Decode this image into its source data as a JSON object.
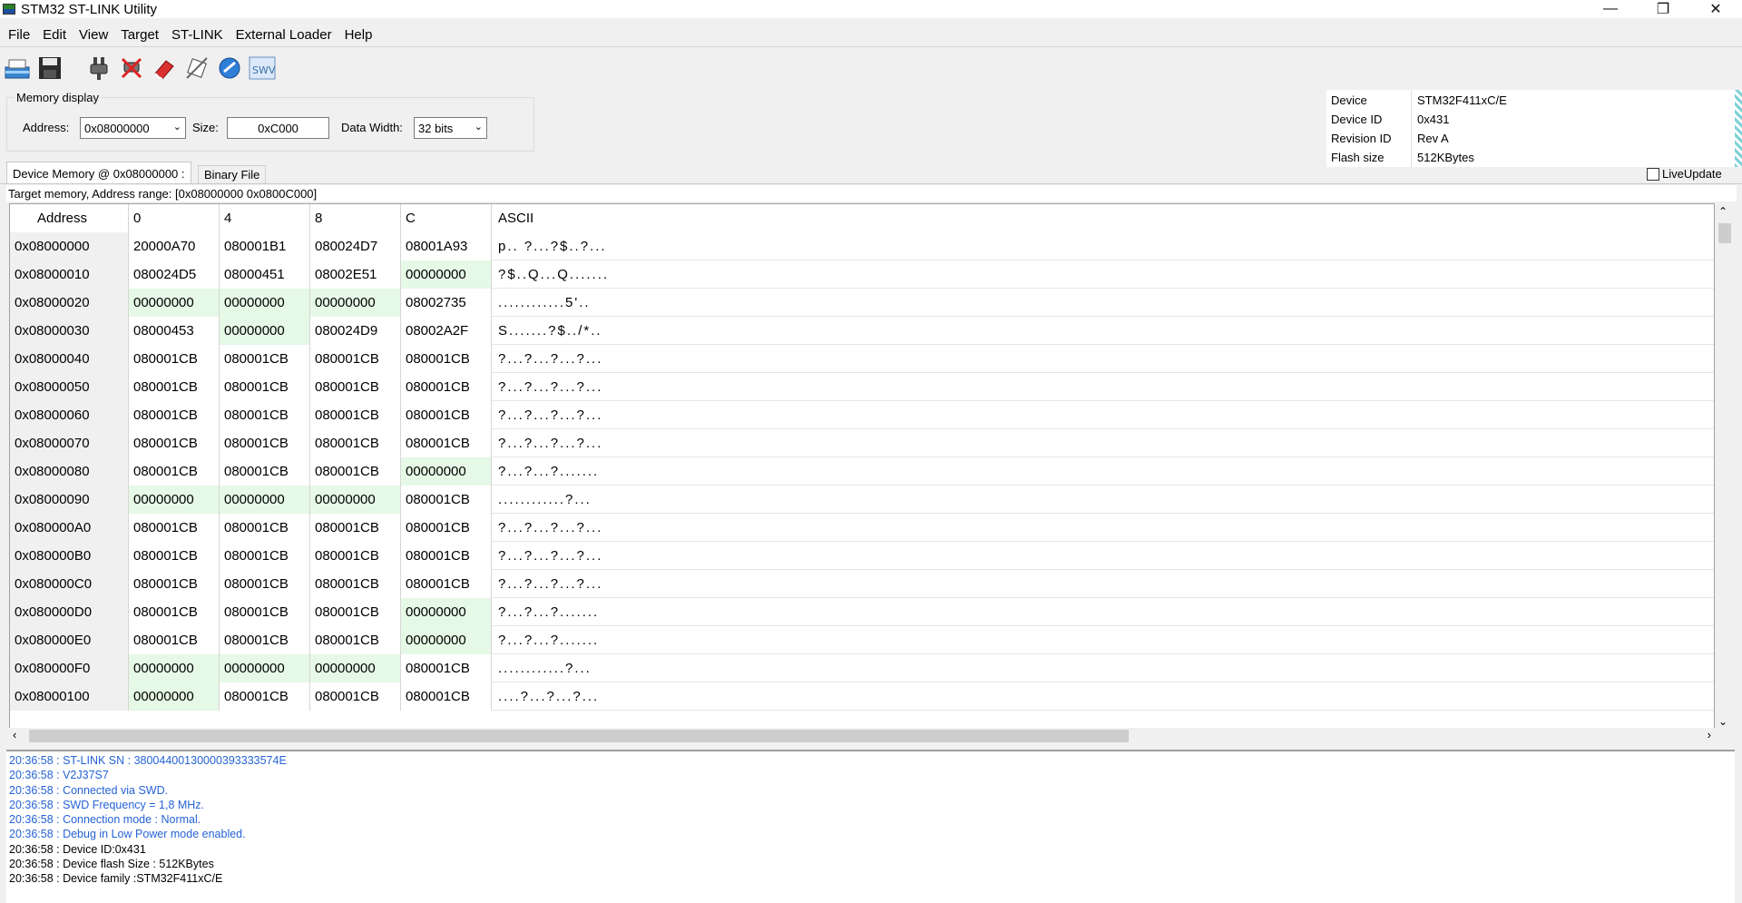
{
  "window": {
    "title": "STM32 ST-LINK Utility",
    "controls": {
      "minimize": "—",
      "restore": "❐",
      "close": "✕"
    }
  },
  "menu": [
    "File",
    "Edit",
    "View",
    "Target",
    "ST-LINK",
    "External Loader",
    "Help"
  ],
  "toolbar": {
    "icons": [
      "open-file-icon",
      "save-icon",
      "connect-icon",
      "disconnect-icon",
      "erase-icon",
      "program-icon",
      "external-loader-icon",
      "swv-icon"
    ],
    "swv_label": "SWV"
  },
  "memory_display": {
    "group_title": "Memory display",
    "address_label": "Address:",
    "address_value": "0x08000000",
    "size_label": "Size:",
    "size_value": "0xC000",
    "width_label": "Data Width:",
    "width_value": "32 bits"
  },
  "device_info": [
    {
      "key": "Device",
      "value": "STM32F411xC/E"
    },
    {
      "key": "Device ID",
      "value": "0x431"
    },
    {
      "key": "Revision ID",
      "value": "Rev A"
    },
    {
      "key": "Flash size",
      "value": "512KBytes"
    }
  ],
  "live_update_label": "LiveUpdate",
  "tabs": {
    "device_memory": "Device Memory @ 0x08000000 :",
    "binary_file": "Binary File"
  },
  "range_text": "Target memory, Address range: [0x08000000 0x0800C000]",
  "table": {
    "headers": [
      "Address",
      "0",
      "4",
      "8",
      "C",
      "ASCII"
    ],
    "rows": [
      {
        "addr": "0x08000000",
        "w": [
          "20000A70",
          "080001B1",
          "080024D7",
          "08001A93"
        ],
        "ascii": "p.. ?...?$..?..."
      },
      {
        "addr": "0x08000010",
        "w": [
          "080024D5",
          "08000451",
          "08002E51",
          "00000000"
        ],
        "ascii": "?$..Q...Q......."
      },
      {
        "addr": "0x08000020",
        "w": [
          "00000000",
          "00000000",
          "00000000",
          "08002735"
        ],
        "ascii": "............5'.."
      },
      {
        "addr": "0x08000030",
        "w": [
          "08000453",
          "00000000",
          "080024D9",
          "08002A2F"
        ],
        "ascii": "S.......?$../*.."
      },
      {
        "addr": "0x08000040",
        "w": [
          "080001CB",
          "080001CB",
          "080001CB",
          "080001CB"
        ],
        "ascii": "?...?...?...?..."
      },
      {
        "addr": "0x08000050",
        "w": [
          "080001CB",
          "080001CB",
          "080001CB",
          "080001CB"
        ],
        "ascii": "?...?...?...?..."
      },
      {
        "addr": "0x08000060",
        "w": [
          "080001CB",
          "080001CB",
          "080001CB",
          "080001CB"
        ],
        "ascii": "?...?...?...?..."
      },
      {
        "addr": "0x08000070",
        "w": [
          "080001CB",
          "080001CB",
          "080001CB",
          "080001CB"
        ],
        "ascii": "?...?...?...?..."
      },
      {
        "addr": "0x08000080",
        "w": [
          "080001CB",
          "080001CB",
          "080001CB",
          "00000000"
        ],
        "ascii": "?...?...?......."
      },
      {
        "addr": "0x08000090",
        "w": [
          "00000000",
          "00000000",
          "00000000",
          "080001CB"
        ],
        "ascii": "............?..."
      },
      {
        "addr": "0x080000A0",
        "w": [
          "080001CB",
          "080001CB",
          "080001CB",
          "080001CB"
        ],
        "ascii": "?...?...?...?..."
      },
      {
        "addr": "0x080000B0",
        "w": [
          "080001CB",
          "080001CB",
          "080001CB",
          "080001CB"
        ],
        "ascii": "?...?...?...?..."
      },
      {
        "addr": "0x080000C0",
        "w": [
          "080001CB",
          "080001CB",
          "080001CB",
          "080001CB"
        ],
        "ascii": "?...?...?...?..."
      },
      {
        "addr": "0x080000D0",
        "w": [
          "080001CB",
          "080001CB",
          "080001CB",
          "00000000"
        ],
        "ascii": "?...?...?......."
      },
      {
        "addr": "0x080000E0",
        "w": [
          "080001CB",
          "080001CB",
          "080001CB",
          "00000000"
        ],
        "ascii": "?...?...?......."
      },
      {
        "addr": "0x080000F0",
        "w": [
          "00000000",
          "00000000",
          "00000000",
          "080001CB"
        ],
        "ascii": "............?..."
      },
      {
        "addr": "0x08000100",
        "w": [
          "00000000",
          "080001CB",
          "080001CB",
          "080001CB"
        ],
        "ascii": "....?...?...?..."
      }
    ]
  },
  "colors": {
    "zero_cell_bg": "#e6f8e6",
    "log_info": "#2563d6"
  },
  "log": [
    {
      "text": "20:36:58 : ST-LINK SN : 38004400130000393333574E",
      "kind": "info"
    },
    {
      "text": "20:36:58 : V2J37S7",
      "kind": "info"
    },
    {
      "text": "20:36:58 : Connected via SWD.",
      "kind": "info"
    },
    {
      "text": "20:36:58 : SWD Frequency = 1,8 MHz.",
      "kind": "info"
    },
    {
      "text": "20:36:58 : Connection mode : Normal.",
      "kind": "info"
    },
    {
      "text": "20:36:58 : Debug in Low Power mode enabled.",
      "kind": "info"
    },
    {
      "text": "20:36:58 : Device ID:0x431",
      "kind": "plain"
    },
    {
      "text": "20:36:58 : Device flash Size : 512KBytes",
      "kind": "plain"
    },
    {
      "text": "20:36:58 : Device family :STM32F411xC/E",
      "kind": "plain"
    }
  ]
}
